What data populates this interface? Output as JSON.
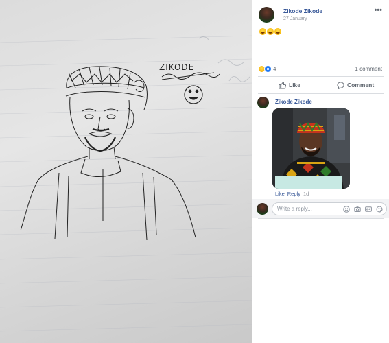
{
  "photo": {
    "signature_text": "ZIKODE"
  },
  "post": {
    "author": "Zikode Zikode",
    "date": "27 January",
    "more_icon": "more-horizontal-icon",
    "text_emojis": [
      "grinning-squinting-face",
      "grinning-squinting-face",
      "grinning-squinting-face"
    ]
  },
  "reactions": {
    "icons": [
      "haha-reaction-icon",
      "like-reaction-icon"
    ],
    "count": "4",
    "comments": "1 comment"
  },
  "actions": {
    "like_label": "Like",
    "comment_label": "Comment"
  },
  "comment": {
    "author": "Zikode Zikode",
    "like_label": "Like",
    "reply_label": "Reply",
    "time": "1d"
  },
  "reply_box": {
    "placeholder": "Write a reply...",
    "tools": [
      "smiley-icon",
      "camera-icon",
      "gif-icon",
      "sticker-icon"
    ]
  },
  "colors": {
    "link_blue": "#385898",
    "like_blue": "#2078f4",
    "muted_gray": "#606770"
  }
}
